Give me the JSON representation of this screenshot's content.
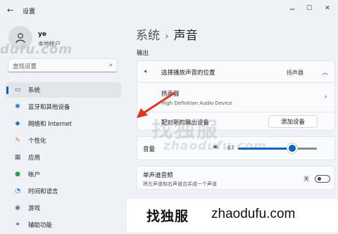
{
  "window": {
    "back_icon": "back-arrow-icon",
    "title": "设置",
    "minimize": "─",
    "maximize": "☐",
    "close": "✕"
  },
  "user": {
    "name": "ye",
    "account": "本地帐户"
  },
  "watermark": {
    "small": "dufu.com",
    "big": "找独服",
    "mid": "zhaodufu.com"
  },
  "search": {
    "placeholder": "查找设置",
    "icon": "search-icon"
  },
  "sidebar": {
    "items": [
      {
        "label": "系统",
        "icon": "monitor-icon",
        "glyph": "▭",
        "color": "#0067c0",
        "active": true
      },
      {
        "label": "蓝牙和其他设备",
        "icon": "bluetooth-icon",
        "glyph": "✱",
        "color": "#1a73d9"
      },
      {
        "label": "网络和 Internet",
        "icon": "wifi-icon",
        "glyph": "◆",
        "color": "#2b6fb5"
      },
      {
        "label": "个性化",
        "icon": "brush-icon",
        "glyph": "✎",
        "color": "#d17a22"
      },
      {
        "label": "应用",
        "icon": "apps-icon",
        "glyph": "▦",
        "color": "#555a66"
      },
      {
        "label": "帐户",
        "icon": "account-icon",
        "glyph": "●",
        "color": "#2e9b5a"
      },
      {
        "label": "时间和语言",
        "icon": "globe-clock-icon",
        "glyph": "◔",
        "color": "#1a73d9"
      },
      {
        "label": "游戏",
        "icon": "gamepad-icon",
        "glyph": "◉",
        "color": "#666a72"
      },
      {
        "label": "辅助功能",
        "icon": "accessibility-icon",
        "glyph": "✦",
        "color": "#1a73d9"
      }
    ]
  },
  "breadcrumb": {
    "parent": "系统",
    "separator": "›",
    "current": "声音"
  },
  "output": {
    "section_label": "输出",
    "choose_label": "选择播放声音的位置",
    "choose_value": "扬声器",
    "device_name": "扬声器",
    "device_desc": "High Definition Audio Device",
    "pair_label": "配对新的输出设备",
    "add_button": "添加设备",
    "volume_label": "音量",
    "volume_value": "67",
    "volume_fraction": 0.67,
    "mono_label": "单声道音频",
    "mono_desc": "将左声道和右声道合并成一个声道",
    "mono_state": "关"
  },
  "footer": {
    "logo": "找独服",
    "domain": "zhaodufu.com"
  },
  "colors": {
    "accent": "#0067c0",
    "arrow": "#e8321e"
  }
}
